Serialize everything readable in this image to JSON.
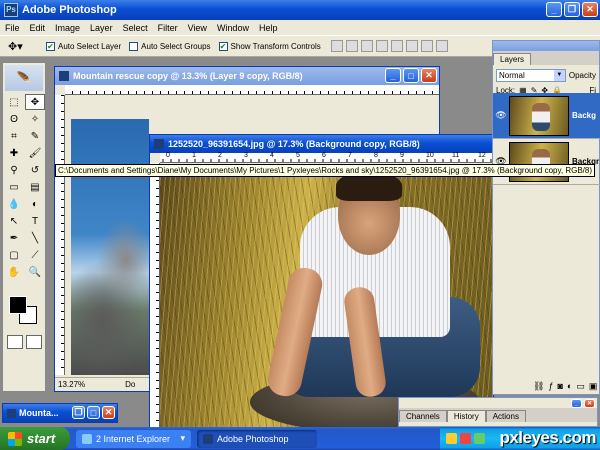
{
  "app": {
    "title": "Adobe Photoshop"
  },
  "menu": [
    "File",
    "Edit",
    "Image",
    "Layer",
    "Select",
    "Filter",
    "View",
    "Window",
    "Help"
  ],
  "options": {
    "auto_select_layer": "Auto Select Layer",
    "auto_select_groups": "Auto Select Groups",
    "show_transform": "Show Transform Controls"
  },
  "doc1": {
    "title": "Mountain rescue copy @ 13.3% (Layer 9 copy, RGB/8)",
    "zoom": "13.27%",
    "status_tail": "Do"
  },
  "doc2": {
    "title": "1252520_96391654.jpg @ 17.3% (Background copy, RGB/8)",
    "ruler": [
      "0",
      "1",
      "2",
      "3",
      "4",
      "5",
      "6",
      "7",
      "8",
      "9",
      "10",
      "11",
      "12",
      "13"
    ]
  },
  "tooltip": "C:\\Documents and Settings\\Diane\\My Documents\\My Pictures\\1 Pyxleyes\\Rocks and sky\\1252520_96391654.jpg @ 17.3% (Background copy, RGB/8)",
  "layers": {
    "tab": "Layers",
    "blend_mode": "Normal",
    "opacity_label": "Opacity",
    "lock_label": "Lock:",
    "fill_label": "Fi",
    "items": [
      {
        "name": "Backg",
        "selected": true
      },
      {
        "name": "Backgr",
        "selected": false
      }
    ]
  },
  "history": {
    "tabs": [
      "Channels",
      "History",
      "Actions"
    ]
  },
  "minimized": {
    "title": "Mounta..."
  },
  "taskbar": {
    "start": "start",
    "tasks": [
      "2 Internet Explorer",
      "Adobe Photoshop"
    ],
    "watermark": "pxleyes.com"
  },
  "colors": {
    "xp_blue": "#0a4fd4",
    "start_green": "#2f8a2f",
    "tooltip": "#ffffe1",
    "layer_selected": "#316ac5"
  }
}
